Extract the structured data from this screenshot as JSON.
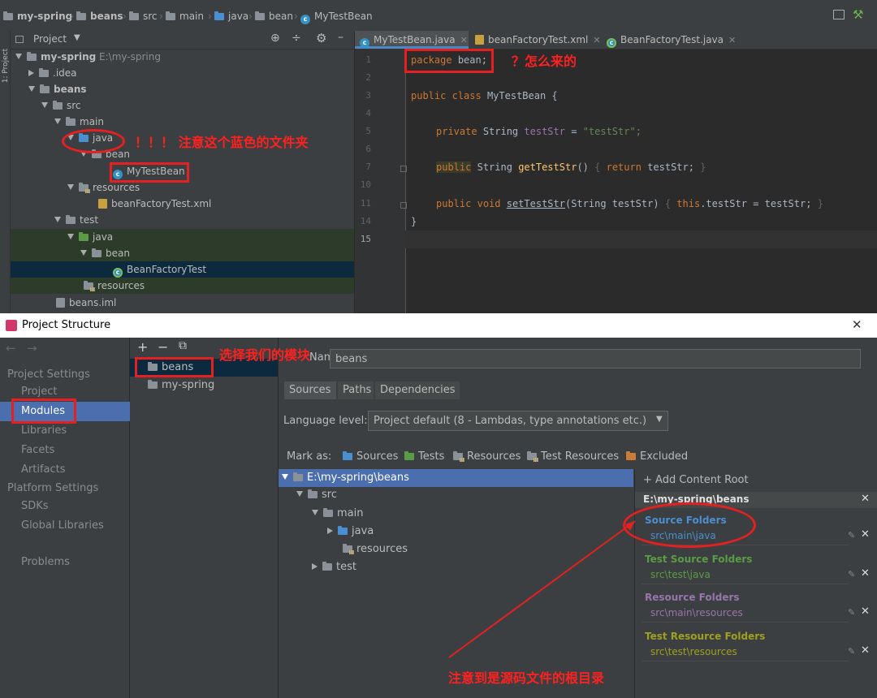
{
  "ide": {
    "breadcrumbs": [
      "my-spring",
      "beans",
      "src",
      "main",
      "java",
      "bean",
      "MyTestBean"
    ],
    "sidebar_strip_label": "1: Project",
    "project_header": "Project",
    "tree": [
      {
        "label": "my-spring",
        "suffix": "E:\\my-spring"
      },
      {
        "label": ".idea"
      },
      {
        "label": "beans"
      },
      {
        "label": "src"
      },
      {
        "label": "main"
      },
      {
        "label": "java"
      },
      {
        "label": "bean"
      },
      {
        "label": "MyTestBean"
      },
      {
        "label": "resources"
      },
      {
        "label": "beanFactoryTest.xml"
      },
      {
        "label": "test"
      },
      {
        "label": "java"
      },
      {
        "label": "bean"
      },
      {
        "label": "BeanFactoryTest"
      },
      {
        "label": "resources"
      },
      {
        "label": "beans.iml"
      }
    ],
    "tabs": [
      {
        "label": "MyTestBean.java",
        "active": true
      },
      {
        "label": "beanFactoryTest.xml",
        "active": false
      },
      {
        "label": "BeanFactoryTest.java",
        "active": false
      }
    ],
    "code": {
      "line_numbers": [
        "1",
        "2",
        "3",
        "4",
        "5",
        "6",
        "7",
        "10",
        "11",
        "14",
        "15"
      ],
      "package_kw": "package",
      "package_name": "bean;",
      "public_kw": "public",
      "class_kw": "class",
      "class_name": "MyTestBean {",
      "private_kw": "private",
      "string_type": "String",
      "field": "testStr",
      "equals": "=",
      "field_value": "\"testStr\";",
      "getter_name": "getTestStr",
      "getter_sig": "()",
      "getter_body_open": "{",
      "return_kw": "return",
      "getter_body_rest": "testStr;",
      "body_close": "}",
      "void_kw": "void",
      "setter_name": "setTestStr",
      "setter_params": "(String testStr)",
      "this_kw": "this",
      "setter_body_rest": ".testStr = testStr;",
      "class_close": "}"
    }
  },
  "dialog": {
    "title": "Project Structure",
    "close": "✕",
    "nav_back": "←",
    "nav_forward": "→",
    "nav": {
      "project_settings_header": "Project Settings",
      "project": "Project",
      "modules": "Modules",
      "libraries": "Libraries",
      "facets": "Facets",
      "artifacts": "Artifacts",
      "platform_settings_header": "Platform Settings",
      "sdks": "SDKs",
      "global_libraries": "Global Libraries",
      "problems": "Problems"
    },
    "module_tools": {
      "add": "+",
      "remove": "−",
      "copy": "⧉"
    },
    "modules": [
      "beans",
      "my-spring"
    ],
    "name_label": "Name:",
    "name_value": "beans",
    "content_tabs": [
      "Sources",
      "Paths",
      "Dependencies"
    ],
    "language_level_label": "Language level:",
    "language_level_value": "Project default (8 - Lambdas, type annotations etc.)",
    "mark_as_label": "Mark as:",
    "mark_as": [
      "Sources",
      "Tests",
      "Resources",
      "Test Resources",
      "Excluded"
    ],
    "content_tree": [
      "E:\\my-spring\\beans",
      "src",
      "main",
      "java",
      "resources",
      "test"
    ],
    "add_content_root": "+ Add Content Root",
    "root_path": "E:\\my-spring\\beans",
    "folders": [
      {
        "header": "Source Folders",
        "path": "src\\main\\java"
      },
      {
        "header": "Test Source Folders",
        "path": "src\\test\\java"
      },
      {
        "header": "Resource Folders",
        "path": "src\\main\\resources"
      },
      {
        "header": "Test Resource Folders",
        "path": "src\\test\\resources"
      }
    ]
  },
  "annotations": {
    "package_question": "？怎么来的",
    "blue_folder_note": "！！！ 注意这个蓝色的文件夹",
    "select_module_note": "选择我们的模块",
    "source_root_note": "注意到是源码文件的根目录"
  },
  "colors": {
    "annotation_red": "#e52020",
    "selection_blue": "#4b6eaf",
    "source_header": "#4a8fcf",
    "test_header": "#5b9b45",
    "resource_header": "#9876aa",
    "test_resource_header": "#a0a020"
  }
}
